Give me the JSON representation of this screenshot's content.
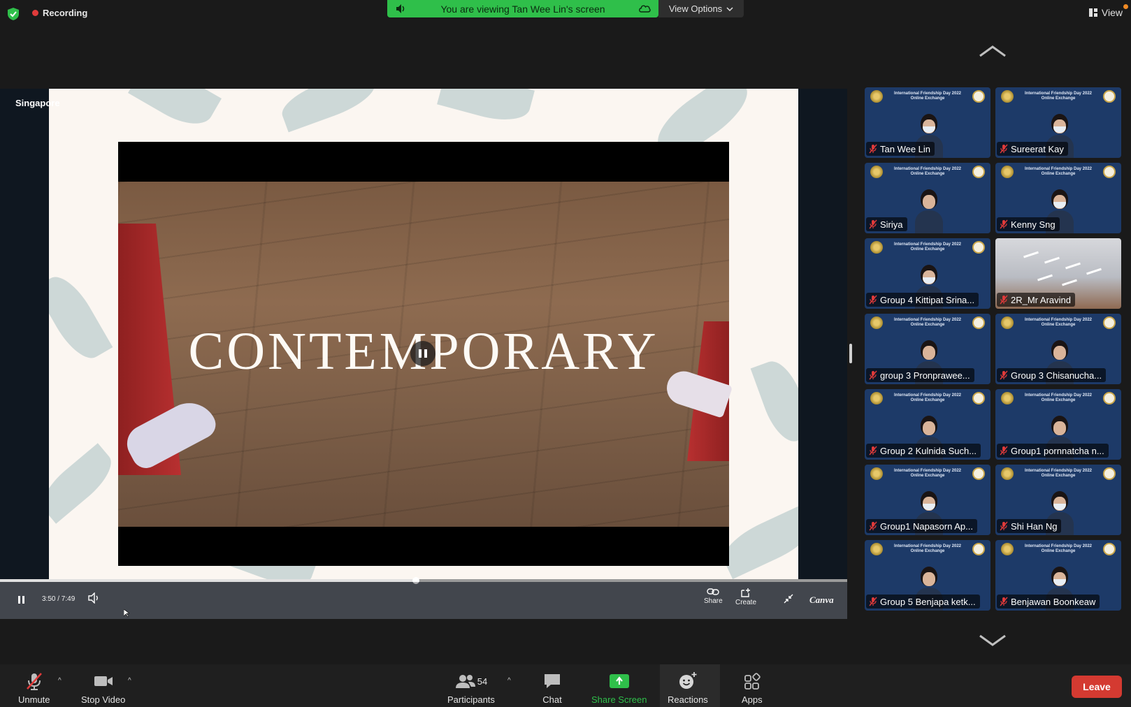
{
  "top_bar": {
    "recording_label": "Recording",
    "viewing_banner": "You are viewing Tan Wee Lin's screen",
    "view_options_label": "View Options",
    "view_label": "View"
  },
  "share": {
    "location_label": "Singapore",
    "slide_title": "CONTEMPORARY",
    "time_current": "3:50",
    "time_total": "7:49",
    "time_display": "3:50 / 7:49",
    "progress_fraction": 0.491,
    "share_label": "Share",
    "create_label": "Create",
    "canva_label": "Canva"
  },
  "gallery": {
    "tile_banner_line1": "International Friendship Day 2022",
    "tile_banner_line2": "Online Exchange",
    "participants": [
      {
        "name": "Tan Wee Lin",
        "muted": true,
        "mask": true
      },
      {
        "name": "Sureerat Kay",
        "muted": true,
        "mask": true
      },
      {
        "name": "Siriya",
        "muted": true,
        "mask": false
      },
      {
        "name": "Kenny Sng",
        "muted": true,
        "mask": true
      },
      {
        "name": "Group 4 Kittipat Srina...",
        "muted": true,
        "mask": true
      },
      {
        "name": "2R_Mr Aravind",
        "muted": true,
        "mask": false
      },
      {
        "name": "group 3 Pronprawee...",
        "muted": true,
        "mask": false
      },
      {
        "name": "Group 3 Chisanucha...",
        "muted": true,
        "mask": false
      },
      {
        "name": "Group 2 Kulnida Such...",
        "muted": true,
        "mask": false
      },
      {
        "name": "Group1 pornnatcha n...",
        "muted": true,
        "mask": false
      },
      {
        "name": "Group1 Napasorn Ap...",
        "muted": true,
        "mask": true
      },
      {
        "name": "Shi Han Ng",
        "muted": true,
        "mask": true
      },
      {
        "name": "Group 5 Benjapa ketk...",
        "muted": true,
        "mask": false
      },
      {
        "name": "Benjawan Boonkeaw",
        "muted": true,
        "mask": true
      }
    ]
  },
  "toolbar": {
    "unmute_label": "Unmute",
    "stop_video_label": "Stop Video",
    "participants_label": "Participants",
    "participants_count": "54",
    "chat_label": "Chat",
    "share_screen_label": "Share Screen",
    "reactions_label": "Reactions",
    "apps_label": "Apps",
    "leave_label": "Leave"
  },
  "colors": {
    "recording_dot": "#e03a3a",
    "viewing_banner": "#2fbf4a",
    "share_screen_icon": "#2fbf4a",
    "leave_button": "#d43a31",
    "tile_background": "#1d3a68",
    "muted_icon": "#e03a3a"
  },
  "icons": {
    "security": "shield-check-icon",
    "speaker": "speaker-icon",
    "cloud": "cloud-icon",
    "gallery_view": "grid-icon",
    "mic": "mic-off-icon",
    "video": "video-camera-icon",
    "participants": "people-icon",
    "chat": "chat-bubble-icon",
    "share": "share-arrow-icon",
    "reactions": "smiley-plus-icon",
    "apps": "apps-icon"
  }
}
